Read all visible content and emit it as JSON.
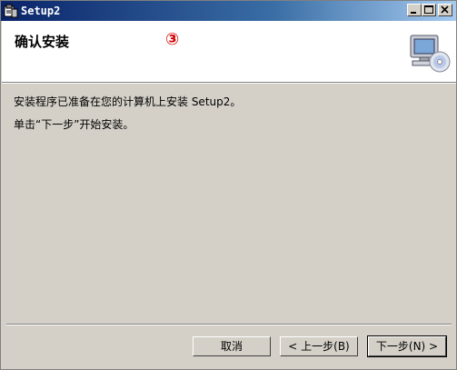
{
  "window": {
    "title": "Setup2"
  },
  "header": {
    "title": "确认安装",
    "step_marker": "③"
  },
  "body": {
    "line1": "安装程序已准备在您的计算机上安装 Setup2。",
    "line2": "单击“下一步”开始安装。"
  },
  "buttons": {
    "cancel": "取消",
    "back": "< 上一步(B)",
    "next": "下一步(N) >"
  },
  "colors": {
    "titlebar_start": "#0a246a",
    "titlebar_end": "#a6caf0",
    "face": "#d4d0c8",
    "step_marker": "#d40000"
  },
  "icons": {
    "app": "setup-app-icon",
    "header": "computer-cd-icon"
  }
}
